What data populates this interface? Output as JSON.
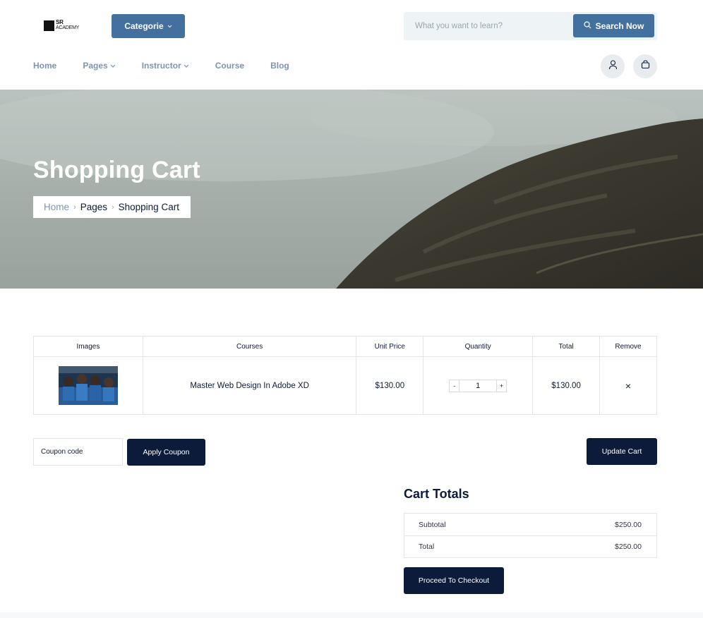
{
  "header": {
    "logo": {
      "line1": "SR",
      "line2": "ACADEMY"
    },
    "category_button": {
      "label": "Categorie",
      "icon": "chevron-down-icon"
    },
    "search": {
      "placeholder": "What you want to learn?",
      "button_label": "Search Now",
      "icon": "search-icon"
    },
    "nav": [
      {
        "label": "Home",
        "has_dropdown": false
      },
      {
        "label": "Pages",
        "has_dropdown": true
      },
      {
        "label": "Instructor",
        "has_dropdown": true
      },
      {
        "label": "Course",
        "has_dropdown": false
      },
      {
        "label": "Blog",
        "has_dropdown": false
      }
    ],
    "icons": [
      "user-icon",
      "shopping-bag-icon"
    ]
  },
  "hero": {
    "title": "Shopping Cart",
    "breadcrumb": {
      "home": "Home",
      "pages": "Pages",
      "current": "Shopping Cart"
    }
  },
  "cart": {
    "columns": [
      "Images",
      "Courses",
      "Unit Price",
      "Quantity",
      "Total",
      "Remove"
    ],
    "items": [
      {
        "course": "Master Web Design In Adobe XD",
        "unit_price": "$130.00",
        "quantity": "1",
        "total": "$130.00",
        "remove": "×"
      }
    ],
    "qty_minus": "-",
    "qty_plus": "+"
  },
  "coupon": {
    "placeholder": "Coupon code",
    "apply_label": "Apply Coupon"
  },
  "update_label": "Update Cart",
  "totals": {
    "title": "Cart Totals",
    "rows": [
      {
        "label": "Subtotal",
        "value": "$250.00"
      },
      {
        "label": "Total",
        "value": "$250.00"
      }
    ],
    "checkout_label": "Proceed To Checkout"
  },
  "colors": {
    "primary": "#44709f",
    "dark": "#0c1b3a",
    "nav_text": "#7c94b4",
    "search_bg": "#eef3f6"
  }
}
